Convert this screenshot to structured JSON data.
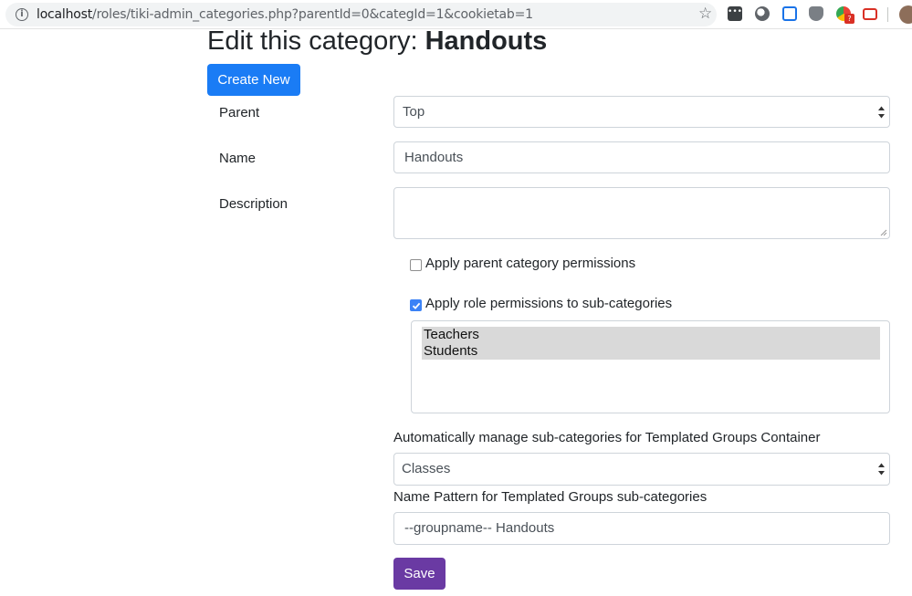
{
  "browser": {
    "url_host": "localhost",
    "url_path": "/roles/tiki-admin_categories.php?parentId=0&categId=1&cookietab=1",
    "extension_badge": "?"
  },
  "page": {
    "title_prefix": "Edit this category:",
    "title_name": "Handouts",
    "create_new_label": "Create New"
  },
  "form": {
    "parent_label": "Parent",
    "parent_value": "Top",
    "name_label": "Name",
    "name_value": "Handouts",
    "description_label": "Description",
    "description_value": "",
    "apply_parent_perms_label": "Apply parent category permissions",
    "apply_parent_perms_checked": false,
    "apply_role_perms_label": "Apply role permissions to sub-categories",
    "apply_role_perms_checked": true,
    "roles": [
      "Teachers",
      "Students"
    ],
    "templated_container_label": "Automatically manage sub-categories for Templated Groups Container",
    "templated_container_value": "Classes",
    "name_pattern_label": "Name Pattern for Templated Groups sub-categories",
    "name_pattern_value": "--groupname-- Handouts",
    "save_label": "Save"
  },
  "colors": {
    "primary": "#1a7cf5",
    "save": "#6a3aa3",
    "checkbox": "#3b82f6"
  }
}
